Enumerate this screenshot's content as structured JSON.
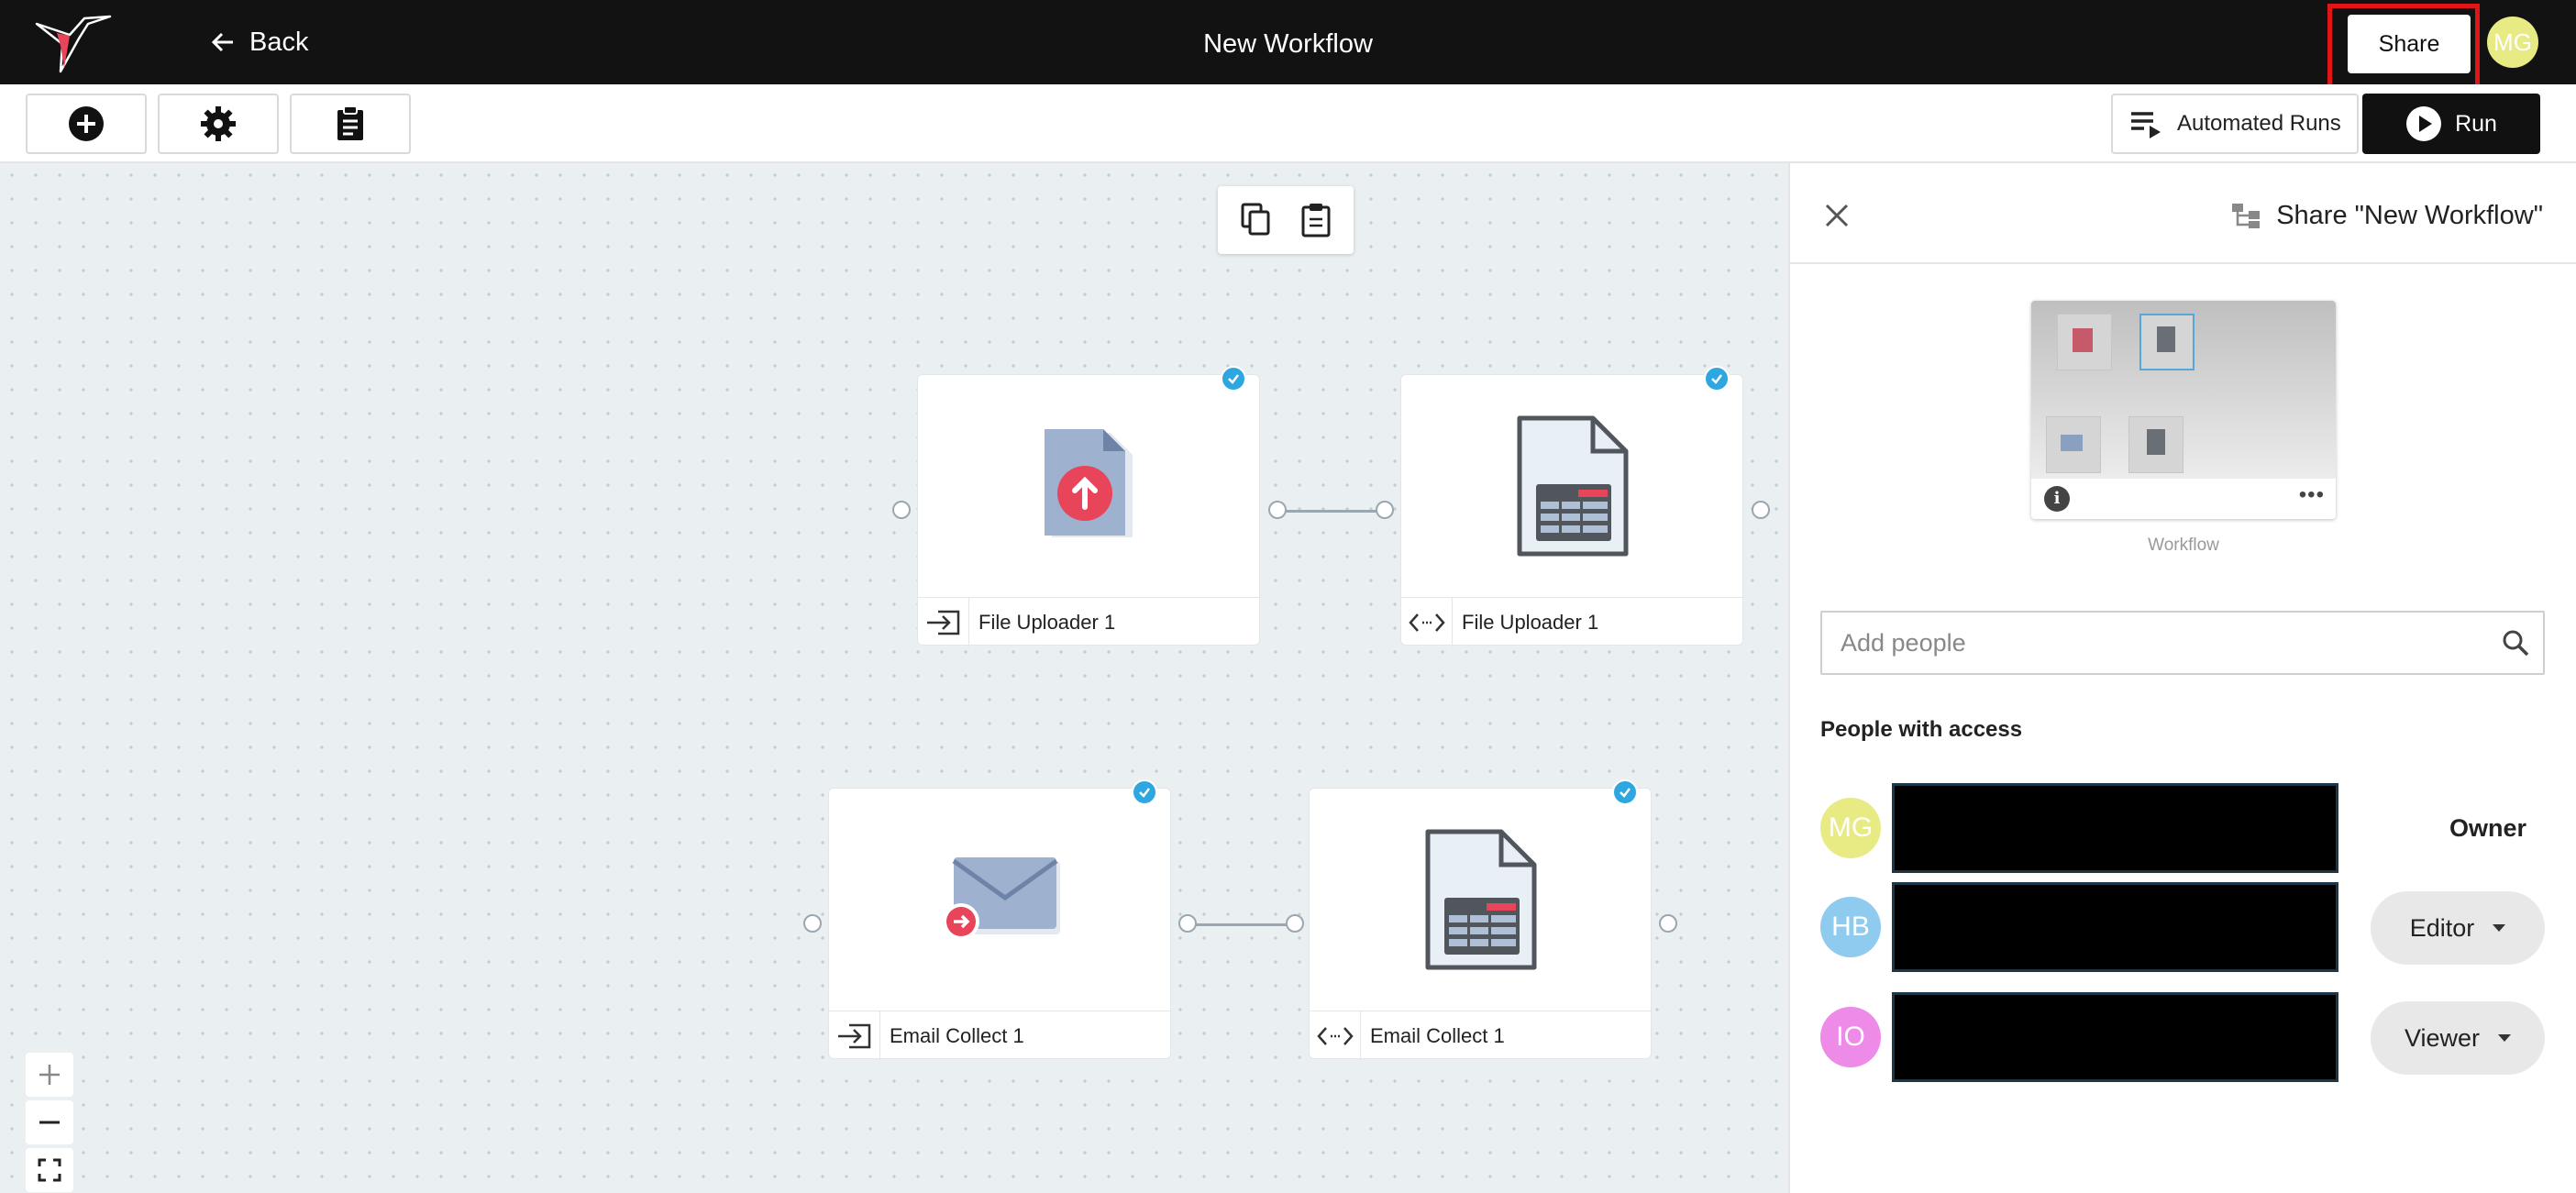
{
  "header": {
    "back_label": "Back",
    "title": "New Workflow",
    "share_label": "Share",
    "avatar_initials": "MG"
  },
  "toolbar": {
    "add_icon": "plus-circle-icon",
    "settings_icon": "gear-icon",
    "clipboard_icon": "clipboard-icon",
    "automated_runs_label": "Automated Runs",
    "run_label": "Run"
  },
  "canvas": {
    "nodes": [
      {
        "label": "File Uploader 1",
        "kind": "input",
        "graphic": "file-upload-icon",
        "checked": true
      },
      {
        "label": "File Uploader 1",
        "kind": "transform",
        "graphic": "spreadsheet-document-icon",
        "checked": true
      },
      {
        "label": "Email Collect 1",
        "kind": "input",
        "graphic": "email-collect-icon",
        "checked": true
      },
      {
        "label": "Email Collect 1",
        "kind": "transform",
        "graphic": "spreadsheet-document-icon",
        "checked": true
      }
    ],
    "zoom_controls": [
      "zoom-in",
      "zoom-out",
      "fit-screen"
    ]
  },
  "share_panel": {
    "title": "Share \"New Workflow\"",
    "preview_label": "Workflow",
    "add_people_placeholder": "Add people",
    "people_heading": "People with access",
    "people": [
      {
        "initials": "MG",
        "avatar_color": "#e8ea84",
        "role": "Owner"
      },
      {
        "initials": "HB",
        "avatar_color": "#8fcbee",
        "role": "Editor"
      },
      {
        "initials": "IO",
        "avatar_color": "#ee8ae8",
        "role": "Viewer"
      }
    ]
  },
  "colors": {
    "header_bg": "#121212",
    "accent_red": "#e8445a",
    "check_blue": "#2ea7e0",
    "highlight_frame": "#e01515"
  }
}
